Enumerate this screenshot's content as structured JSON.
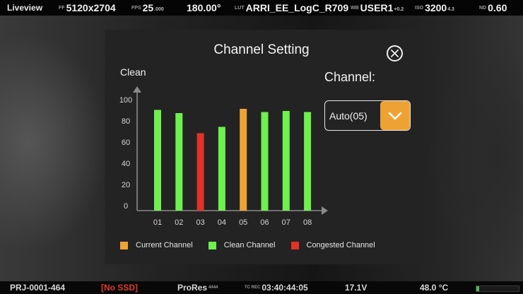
{
  "topbar": {
    "mode": "Liveview",
    "ff_label": "FF",
    "resolution": "5120x2704",
    "fps_label": "FPS",
    "fps_value": "25",
    "fps_decimal": ".000",
    "shutter": "180.00°",
    "lut_label": "LUT",
    "lut_value": "ARRI_EE_LogC_R709",
    "wb_label": "WB",
    "wb_value": "USER1",
    "wb_offset": "+0.2",
    "iso_label": "ISO",
    "iso_value": "3200",
    "iso_stop": "4.3",
    "nd_label": "ND",
    "nd_value": "0.60"
  },
  "dialog": {
    "title": "Channel Setting",
    "chart_label": "Clean",
    "channel_label": "Channel:",
    "channel_select_value": "Auto(05)"
  },
  "legend": {
    "current": "Current Channel",
    "clean": "Clean Channel",
    "congested": "Congested Channel"
  },
  "colors": {
    "current": "#efa234",
    "clean": "#6ef04e",
    "congested": "#e3322a",
    "accent": "#efa234"
  },
  "icons": {
    "close": "close-circle-icon",
    "dropdown": "chevron-down-icon"
  },
  "chart_data": {
    "type": "bar",
    "title": "Clean",
    "categories": [
      "01",
      "02",
      "03",
      "04",
      "05",
      "06",
      "07",
      "08"
    ],
    "values": [
      95,
      92,
      73,
      79,
      96,
      93,
      94,
      93
    ],
    "status": [
      "clean",
      "clean",
      "congested",
      "clean",
      "current",
      "clean",
      "clean",
      "clean"
    ],
    "yticks": [
      "0",
      "20",
      "40",
      "60",
      "80",
      "100"
    ],
    "ylim": [
      0,
      100
    ],
    "grid": false,
    "legend_position": "bottom"
  },
  "botbar": {
    "project": "PRJ-0001-464",
    "ssd": "[No SSD]",
    "codec": "ProRes",
    "codec_sub": "4444",
    "tc_label": "TC REC",
    "timecode": "03:40:44:05",
    "voltage": "17.1V",
    "temperature": "48.0 °C"
  }
}
